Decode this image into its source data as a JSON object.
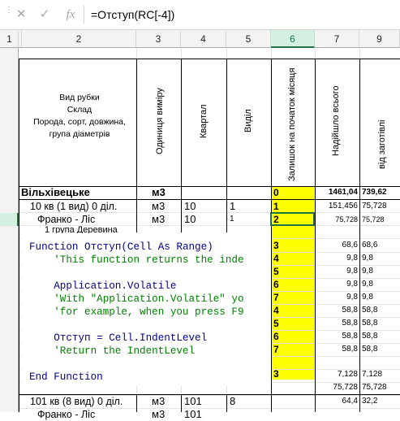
{
  "formula_bar": {
    "formula": "=Отступ(RC[-4])",
    "cancel_icon": "cancel-icon",
    "enter_icon": "check-icon",
    "fx_label": "fx",
    "more_icon": "more-options-icon"
  },
  "columns": [
    "1",
    "2",
    "3",
    "4",
    "5",
    "6",
    "7",
    "9"
  ],
  "selected_column": "6",
  "header": {
    "col2_lines": [
      "Вид рубки",
      "Склад",
      "Порода, сорт, довжина,",
      "група діаметрів"
    ],
    "col3": "Одиниця виміру",
    "col4": "Квартал",
    "col5": "Виділ",
    "col6": "Залишок на початок місяця",
    "col7": "Надійшло всього",
    "col9": "від заготівлі"
  },
  "rows": [
    {
      "c2": "Вільхівецьке",
      "c3": "м3",
      "c4": "",
      "c5": "",
      "c6": "0",
      "c7": "1461,04",
      "c9": "739,62"
    },
    {
      "c2": "10 кв (1 вид) 0 діл.",
      "c3": "м3",
      "c4": "10",
      "c5": "1",
      "c6": "1",
      "c7": "151,456",
      "c9": "75,728"
    },
    {
      "c2": "Франко - Ліс",
      "c3": "м3",
      "c4": "10",
      "c5": "1",
      "c6": "2",
      "c7": "75,728",
      "c9": "75,728"
    },
    {
      "c2": "1 група Деревина",
      "c3": "",
      "c4": "",
      "c5": "",
      "c6": "",
      "c7": "",
      "c9": ""
    }
  ],
  "col6_values": [
    "3",
    "4",
    "5",
    "6",
    "7",
    "4",
    "5",
    "6",
    "7",
    "",
    "3"
  ],
  "col7_values": [
    "68,6",
    "9,8",
    "9,8",
    "9,8",
    "9,8",
    "58,8",
    "58,8",
    "58,8",
    "58,8",
    "",
    "7,128",
    "75,728"
  ],
  "col9_values": [
    "68,6",
    "9,8",
    "9,8",
    "9,8",
    "9,8",
    "58,8",
    "58,8",
    "58,8",
    "58,8",
    "",
    "7,128",
    "75,728"
  ],
  "bottom_row": {
    "c2": "101 кв (8 вид) 0 діл.",
    "c3": "м3",
    "c4": "101",
    "c5": "8",
    "c7": "64,4",
    "c9": "32,2"
  },
  "cut_row": {
    "c2": "Франко - Ліс",
    "c3": "м3",
    "c4": "101"
  },
  "code": {
    "l1_kw": "Function",
    "l1_rest": " Отступ(Cell As Range)",
    "l2": "    'This function returns the inde",
    "l3": "    Application.Volatile",
    "l4": "    'With \"Application.Volatile\" yo",
    "l5": "    'for example, when you press F9",
    "l6": "    Отступ = Cell.IndentLevel",
    "l7": "    'Return the IndentLevel",
    "l8": "End Function"
  }
}
